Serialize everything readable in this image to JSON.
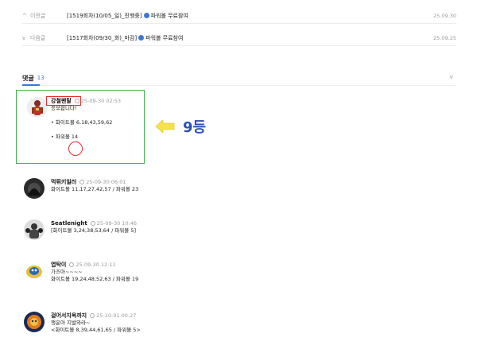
{
  "nav": {
    "prev": {
      "label": "이전글",
      "title_prefix": "[1519회차(10/05_일)_진행중]",
      "title_suffix": "파워볼 무료참여",
      "date": "25.09.30"
    },
    "next": {
      "label": "다음글",
      "title_prefix": "[1517회차(09/30_화)_마감]",
      "title_suffix": "파워볼 무료참여",
      "date": "25.09.25"
    }
  },
  "comments": {
    "label": "댓글",
    "count": "13",
    "items": [
      {
        "author": "강철팬탈",
        "time": "25-09-30 02:53",
        "lines": [
          "응모합니다!",
          "",
          "• 화이트볼 6,18,43,59,62",
          "",
          "• 파워볼 14"
        ]
      },
      {
        "author": "먹튀키일러",
        "time": "25-09-30 06:01",
        "lines": [
          "화이트볼 11,17,27,42,57 / 파워볼 23"
        ]
      },
      {
        "author": "Seatlenight",
        "time": "25-09-30 10:46",
        "lines": [
          "[화이트볼 3,24,38,53,64 / 파워볼 5]"
        ]
      },
      {
        "author": "엽탁이",
        "time": "25-09-30 12:11",
        "lines": [
          "가즈아~~~~",
          "화이트볼 19,24,48,52,63 / 파워볼 19"
        ]
      },
      {
        "author": "걸어서지옥까지",
        "time": "25-10-01 00:27",
        "lines": [
          "행운아 지발와라~",
          "<화이트볼 8,39,44,61,65 / 파워볼 5>"
        ]
      }
    ]
  },
  "annotation": {
    "rank_text": "9등",
    "arrow_color": "#f7e24a",
    "text_color": "#2a4fb8"
  },
  "colors": {
    "accent": "#3a78d8",
    "highlight_green": "#3fb34f",
    "mark_red": "#e03030"
  }
}
